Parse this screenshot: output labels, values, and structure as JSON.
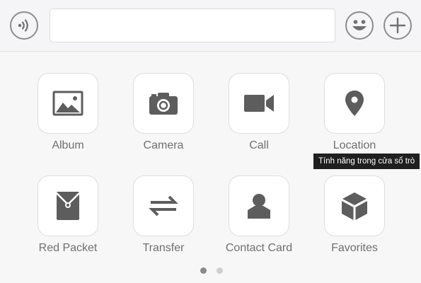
{
  "input_bar": {
    "voice_button_icon": "voice-icon",
    "emoji_button_icon": "smiley-icon",
    "more_button_icon": "plus-icon",
    "message_value": ""
  },
  "actions": [
    {
      "label": "Album",
      "icon": "image-icon"
    },
    {
      "label": "Camera",
      "icon": "camera-icon"
    },
    {
      "label": "Call",
      "icon": "video-camera-icon"
    },
    {
      "label": "Location",
      "icon": "location-pin-icon"
    },
    {
      "label": "Red Packet",
      "icon": "red-packet-icon"
    },
    {
      "label": "Transfer",
      "icon": "transfer-arrows-icon"
    },
    {
      "label": "Contact Card",
      "icon": "contact-person-icon"
    },
    {
      "label": "Favorites",
      "icon": "cube-icon"
    }
  ],
  "tooltip": {
    "text": "Tính năng trong cửa sổ trò"
  },
  "pager": {
    "current_page": 1,
    "total_pages": 2
  },
  "colors": {
    "icon": "#5d5d5d",
    "label": "#6f6f6f",
    "tile_border": "#dedede"
  }
}
